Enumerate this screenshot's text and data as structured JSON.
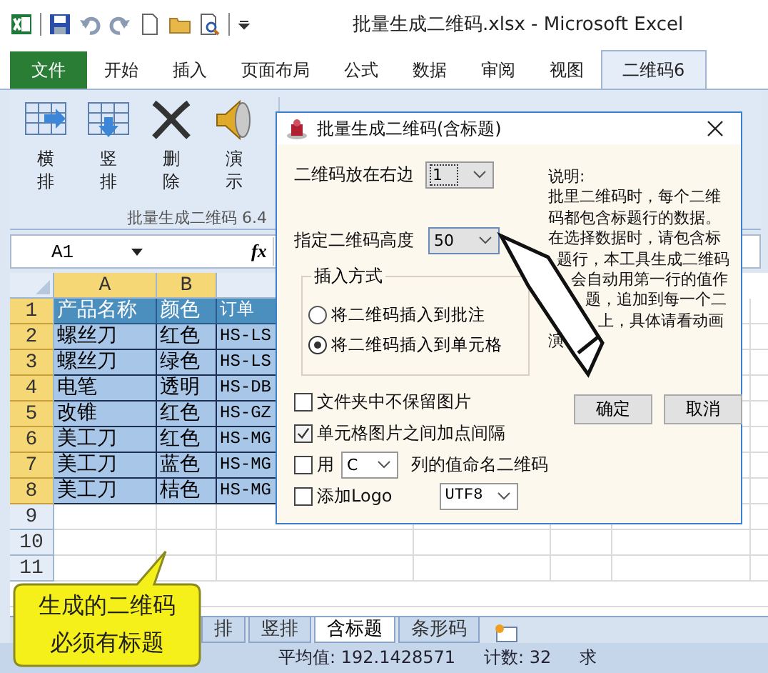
{
  "window": {
    "title": "批量生成二维码.xlsx - Microsoft Excel"
  },
  "ribbon_tabs": [
    {
      "label": "文件",
      "kind": "file",
      "selected": false
    },
    {
      "label": "开始",
      "kind": "tab",
      "selected": false
    },
    {
      "label": "插入",
      "kind": "tab",
      "selected": false
    },
    {
      "label": "页面布局",
      "kind": "tab",
      "selected": false
    },
    {
      "label": "公式",
      "kind": "tab",
      "selected": false
    },
    {
      "label": "数据",
      "kind": "tab",
      "selected": false
    },
    {
      "label": "审阅",
      "kind": "tab",
      "selected": false
    },
    {
      "label": "视图",
      "kind": "tab",
      "selected": false
    },
    {
      "label": "二维码6",
      "kind": "tab",
      "selected": true
    }
  ],
  "ribbon_buttons": [
    {
      "label": "横排",
      "kind": "table-right"
    },
    {
      "label": "竖排",
      "kind": "table-down"
    },
    {
      "label": "删除",
      "kind": "delete"
    },
    {
      "label": "演示",
      "kind": "speaker"
    }
  ],
  "ribbon_group": "批量生成二维码 6.4",
  "name_box": "A1",
  "function_label": "fx",
  "sheet": {
    "columns": [
      {
        "label": "A",
        "selected": true
      },
      {
        "label": "B",
        "selected": true
      }
    ],
    "rows": [
      {
        "number": "1",
        "selected": true,
        "kind": "header",
        "cells": [
          "产品名称",
          "颜色",
          "订单"
        ]
      },
      {
        "number": "2",
        "selected": true,
        "kind": "data",
        "cells": [
          "螺丝刀",
          "红色",
          "HS-LS"
        ]
      },
      {
        "number": "3",
        "selected": true,
        "kind": "data",
        "cells": [
          "螺丝刀",
          "绿色",
          "HS-LS"
        ]
      },
      {
        "number": "4",
        "selected": true,
        "kind": "data",
        "cells": [
          "电笔",
          "透明",
          "HS-DB"
        ]
      },
      {
        "number": "5",
        "selected": true,
        "kind": "data",
        "cells": [
          "改锥",
          "红色",
          "HS-GZ"
        ]
      },
      {
        "number": "6",
        "selected": true,
        "kind": "data",
        "cells": [
          "美工刀",
          "红色",
          "HS-MG"
        ]
      },
      {
        "number": "7",
        "selected": true,
        "kind": "data",
        "cells": [
          "美工刀",
          "蓝色",
          "HS-MG"
        ]
      },
      {
        "number": "8",
        "selected": true,
        "kind": "data",
        "cells": [
          "美工刀",
          "桔色",
          "HS-MG"
        ]
      },
      {
        "number": "9",
        "selected": false,
        "kind": "data"
      },
      {
        "number": "10",
        "selected": false,
        "kind": "data"
      },
      {
        "number": "11",
        "selected": false,
        "kind": "data"
      }
    ]
  },
  "dialog": {
    "title": "批量生成二维码(含标题)",
    "position_label": "二维码放在右边",
    "position_value": "1",
    "height_label": "指定二维码高度",
    "height_value": "50",
    "insert_group": {
      "title": "插入方式",
      "options": [
        {
          "label": "将二维码插入到批注",
          "selected": false
        },
        {
          "label": "将二维码插入到单元格",
          "selected": true
        }
      ]
    },
    "options": [
      {
        "kind": "plain",
        "label": "文件夹中不保留图片",
        "checked": false
      },
      {
        "kind": "plain",
        "label": "单元格图片之间加点间隔",
        "checked": true
      },
      {
        "kind": "column",
        "label": "用",
        "value": "C",
        "suffix": "列的值命名二维码",
        "checked": false
      },
      {
        "kind": "logo",
        "label": "添加Logo",
        "value": "UTF8",
        "checked": false
      }
    ],
    "note": [
      "说明:",
      "批里二维码时，每个二维",
      "码都包含标题行的数据。",
      "在选择数据时，请包含标",
      "题行，本工具生成二维码",
      "会自动用第一行的值作",
      "题，追加到每一个二",
      "上，具体请看动画",
      "演"
    ],
    "buttons": [
      "确定",
      "取消"
    ]
  },
  "callout": {
    "lines": [
      "生成的二维码",
      "必须有标题"
    ]
  },
  "sheet_tabs": [
    {
      "label": "排",
      "selected": false
    },
    {
      "label": "竖排",
      "selected": false
    },
    {
      "label": "含标题",
      "selected": true
    },
    {
      "label": "条形码",
      "selected": false
    }
  ],
  "status_bar": {
    "average": "平均值: 192.1428571",
    "count": "计数: 32",
    "sum": "求"
  }
}
